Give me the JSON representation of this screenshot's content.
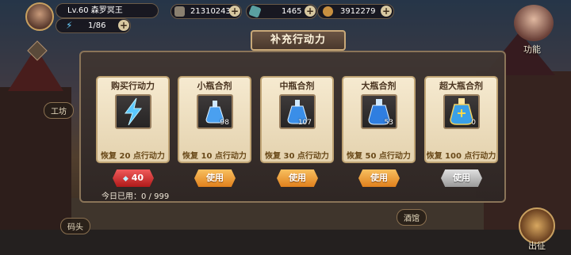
{
  "player": {
    "level_name": "Lv.60 森罗冥王",
    "energy": "1/86"
  },
  "resources": {
    "gold": "21310243",
    "gems": "1465",
    "coins": "3912279"
  },
  "right_menu": {
    "function_label": "功能",
    "deploy_label": "出征"
  },
  "side_labels": {
    "workshop": "工坊",
    "dock": "码头",
    "tavern": "酒馆"
  },
  "dialog": {
    "title": "补充行动力",
    "daily_used_label": "今日已用：0 / 999",
    "cards": [
      {
        "name": "购买行动力",
        "count": "",
        "effect": "恢复 20 点行动力",
        "button": "40"
      },
      {
        "name": "小瓶合剂",
        "count": "98",
        "effect": "恢复 10 点行动力",
        "button": "使用"
      },
      {
        "name": "中瓶合剂",
        "count": "107",
        "effect": "恢复 30 点行动力",
        "button": "使用"
      },
      {
        "name": "大瓶合剂",
        "count": "53",
        "effect": "恢复 50 点行动力",
        "button": "使用"
      },
      {
        "name": "超大瓶合剂",
        "count": "0",
        "effect": "恢复 100 点行动力",
        "button": "使用"
      }
    ]
  },
  "icons": {
    "buy": "lightning-icon",
    "potion": "potion-flask-icon"
  }
}
